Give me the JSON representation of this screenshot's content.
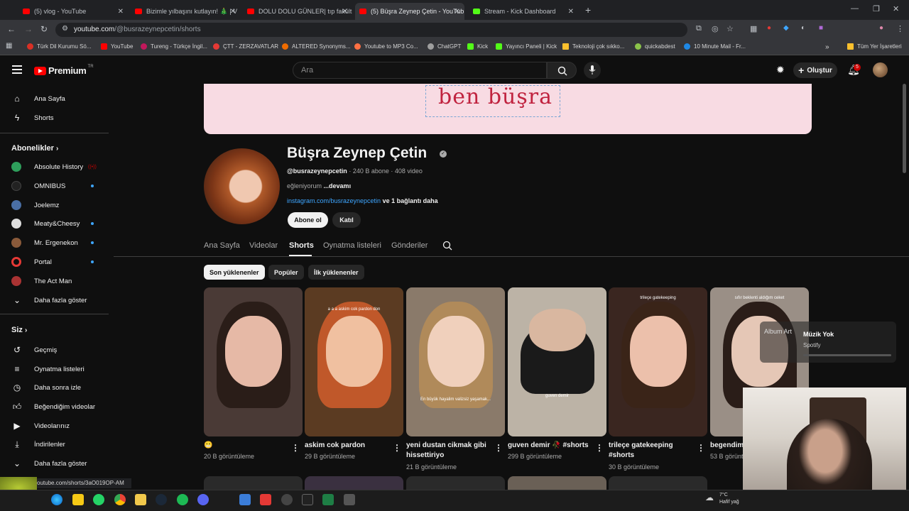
{
  "browser": {
    "tabs": [
      {
        "label": "(5) vlog - YouTube",
        "color": "#ff0000"
      },
      {
        "label": "Bizimle yılbaşını kutlayın! 🎄 | V",
        "color": "#ff0000"
      },
      {
        "label": "DOLU DOLU GÜNLER| tıp fakült",
        "color": "#ff0000"
      },
      {
        "label": "(5) Büşra Zeynep Çetin - YouTub",
        "color": "#ff0000"
      },
      {
        "label": "Stream - Kick Dashboard",
        "color": "#53fc18"
      }
    ],
    "url_host": "youtube.com",
    "url_path": "/@busrazeynepcetin/shorts",
    "new_tab": "+",
    "bookmarks": [
      {
        "label": "Türk Dil Kurumu Sö...",
        "color": "#d93025"
      },
      {
        "label": "YouTube",
        "color": "#ff0000"
      },
      {
        "label": "Tureng - Türkçe İngil...",
        "color": "#c2185b"
      },
      {
        "label": "ÇTT - ZERZAVATLAR",
        "color": "#e53935"
      },
      {
        "label": "ALTERED Synonyms...",
        "color": "#ef6c00"
      },
      {
        "label": "Youtube to MP3 Co...",
        "color": "#ff7043"
      },
      {
        "label": "ChatGPT",
        "color": "#9e9e9e"
      },
      {
        "label": "Kick",
        "color": "#53fc18"
      },
      {
        "label": "Yayıncı Paneli | Kick",
        "color": "#53fc18"
      },
      {
        "label": "Teknoloji çok sıkko...",
        "color": "#fbc02d"
      },
      {
        "label": "quickabdest",
        "color": "#8bc34a"
      },
      {
        "label": "10 Minute Mail - Fr...",
        "color": "#1e88e5"
      }
    ],
    "all_bookmarks": "Tüm Yer İşaretleri",
    "status_url": "youtube.com/shorts/3aO019OP-AM"
  },
  "header": {
    "logo": "Premium",
    "logo_sup": "TR",
    "search_placeholder": "Ara",
    "create_label": "Oluştur",
    "notif_count": "5"
  },
  "sidebar": {
    "main": [
      {
        "label": "Ana Sayfa",
        "icon": "home-icon"
      },
      {
        "label": "Shorts",
        "icon": "shorts-icon"
      }
    ],
    "subs_title": "Abonelikler",
    "subs": [
      {
        "label": "Absolute History",
        "color": "#2e9e5b",
        "live": true
      },
      {
        "label": "OMNIBUS",
        "color": "#111111",
        "live": false
      },
      {
        "label": "Joelemz",
        "color": "#4a6fa5",
        "live": false
      },
      {
        "label": "Meaty&Cheesy",
        "color": "#dddddd",
        "live": false
      },
      {
        "label": "Mr. Ergenekon",
        "color": "#8a5a3a",
        "live": false
      },
      {
        "label": "Portal",
        "color": "#e53935",
        "live": false
      },
      {
        "label": "The Act Man",
        "color": "#a33",
        "live": false
      }
    ],
    "subs_more": "Daha fazla göster",
    "you_title": "Siz",
    "you": [
      {
        "label": "Geçmiş",
        "icon": "history-icon"
      },
      {
        "label": "Oynatma listeleri",
        "icon": "playlist-icon"
      },
      {
        "label": "Daha sonra izle",
        "icon": "clock-icon"
      },
      {
        "label": "Beğendiğim videolar",
        "icon": "like-icon"
      },
      {
        "label": "Videolarınız",
        "icon": "video-icon"
      },
      {
        "label": "İndirilenler",
        "icon": "download-icon"
      },
      {
        "label": "Daha fazla göster",
        "icon": "chevron-down-icon"
      }
    ]
  },
  "channel": {
    "banner_text": "ben büşra",
    "name": "Büşra Zeynep Çetin",
    "handle": "@busrazeynepcetin",
    "stats": "· 240 B abone · 408 video",
    "desc": "eğleniyorum",
    "desc_more": "...devamı",
    "link": "instagram.com/busrazeynepcetin",
    "link_more": "ve 1 bağlantı daha",
    "subscribe": "Abone ol",
    "join": "Katıl",
    "tabs": [
      "Ana Sayfa",
      "Videolar",
      "Shorts",
      "Oynatma listeleri",
      "Gönderiler"
    ],
    "active_tab": "Shorts",
    "chips": [
      "Son yüklenenler",
      "Popüler",
      "İlk yüklenenler"
    ]
  },
  "shorts": [
    {
      "title": "😬",
      "views": "20 B görüntüleme",
      "caption": "",
      "bg": "#4a3a36",
      "skin": "#e6b9a6",
      "hair": "#2a1d18"
    },
    {
      "title": "askim cok pardon",
      "views": "29 B görüntüleme",
      "caption": "a a a askim cok pardon don",
      "bg": "#5b3b22",
      "skin": "#f0c0a0",
      "hair": "#c0582a"
    },
    {
      "title": "yeni dustan cikmak gibi hissettiriyo",
      "views": "21 B görüntüleme",
      "caption": "En büyük hayalim valizsiz yaşamak...",
      "bg": "#8a7a6a",
      "skin": "#f0d0bc",
      "hair": "#b08a5a"
    },
    {
      "title": "guven demir 🥀 #shorts",
      "views": "299 B görüntüleme",
      "caption": "guven demir",
      "bg": "#bcb3a6",
      "skin": "#d9b7a0",
      "hair": "#1a1a1a"
    },
    {
      "title": "trileçe gatekeeping #shorts",
      "views": "30 B görüntüleme",
      "caption": "trileçe gatekeeping",
      "bg": "#3a2620",
      "skin": "#ecc0ab",
      "hair": "#3a2418"
    },
    {
      "title": "begendim",
      "views": "53 B görüntüleme",
      "caption": "sıfır beklenti aldığım ceket",
      "bg": "#9a8f86",
      "skin": "#e5c7b6",
      "hair": "#2a1d18"
    }
  ],
  "spotify": {
    "album": "Album Art",
    "title": "Müzik Yok",
    "source": "Spotify"
  },
  "weather": {
    "temp": "7°C",
    "desc": "Hafif yağ"
  }
}
